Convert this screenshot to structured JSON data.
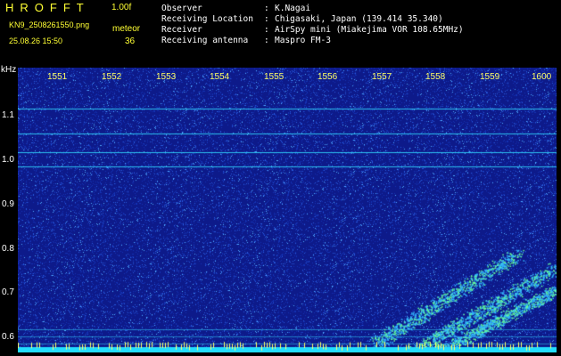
{
  "header": {
    "app_title": "HROFFT",
    "version": "1.00f",
    "filename": "KN9_2508261550.png",
    "meteor_label": "meteor",
    "datetime": "25.08.26 15:50",
    "meteor_count": "36"
  },
  "info": [
    {
      "label": "Observer",
      "value": "K.Nagai"
    },
    {
      "label": "Receiving Location",
      "value": "Chigasaki, Japan (139.414 35.340)"
    },
    {
      "label": "Receiver",
      "value": "AirSpy mini (Miakejima VOR 108.65MHz)"
    },
    {
      "label": "Receiving antenna",
      "value": "Maspro FM-3"
    }
  ],
  "plot": {
    "y_unit": "kHz",
    "x_ticks": [
      "1551",
      "1552",
      "1553",
      "1554",
      "1555",
      "1556",
      "1557",
      "1558",
      "1559",
      "1600"
    ],
    "y_ticks": [
      "1.1",
      "1.0",
      "0.9",
      "0.8",
      "0.7",
      "0.6"
    ],
    "colors": {
      "background": "#0d1a8a",
      "tick_text": "#ffff66",
      "carrier": "#33ddff"
    }
  }
}
